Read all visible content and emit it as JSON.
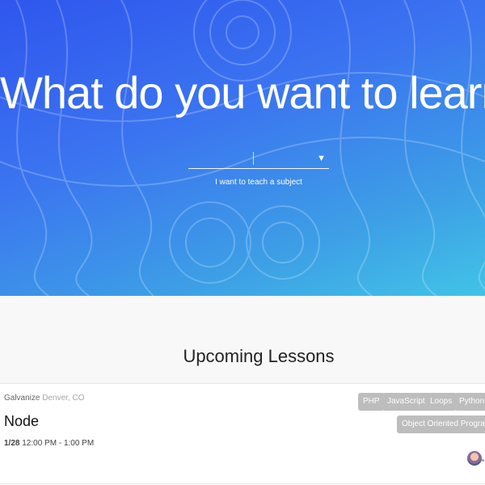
{
  "hero": {
    "title": "What do you want to learn?",
    "subject_select": {
      "value": "",
      "caret_icon": "caret-down-icon"
    },
    "teach_link": "I want to teach a subject",
    "colors": {
      "gradient_start": "#2f56ee",
      "gradient_end": "#41c3e6"
    }
  },
  "lessons": {
    "heading": "Upcoming Lessons",
    "items": [
      {
        "venue_name": "Galvanize",
        "venue_city": "Denver, CO",
        "title": "Node",
        "date": "1/28",
        "time": "12:00 PM - 1:00 PM",
        "tags": [
          "PHP",
          "JavaScript",
          "Loops",
          "Python",
          "Object Oriented Programmin"
        ],
        "avatar_icon": "user-avatar"
      }
    ],
    "colors": {
      "tag_bg": "#bdbdbd",
      "section_bg": "#f8f8f8"
    }
  }
}
